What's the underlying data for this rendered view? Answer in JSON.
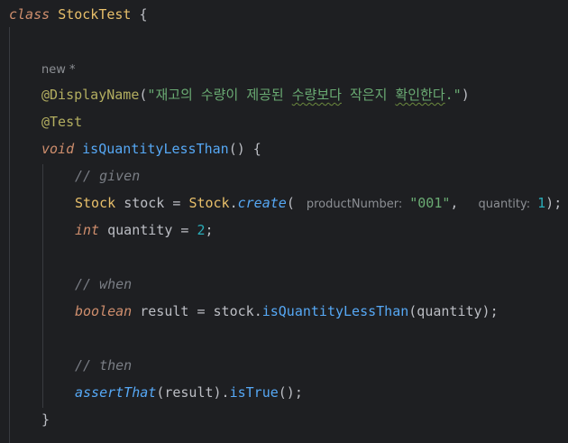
{
  "editor": {
    "lines": {
      "class_kw": "class",
      "class_name": "StockTest",
      "class_open": " {",
      "new_hint": "new *",
      "display_name_ann": "@DisplayName",
      "display_name_open": "(",
      "display_name_quote_open": "\"",
      "display_name_w1": "재고의",
      "display_name_w2": "수량이",
      "display_name_w3": "제공된",
      "display_name_w4": "수량보다",
      "display_name_w5": "작은지",
      "display_name_w6": "확인한다",
      "display_name_w6b": ".",
      "display_name_quote_close": "\"",
      "display_name_close": ")",
      "test_ann": "@Test",
      "method_type": "void",
      "method_name": "isQuantityLessThan",
      "method_sig_rest": "() {",
      "comment_given": "// given",
      "stock_type": "Stock",
      "stock_var": "stock",
      "assign": "=",
      "stock_class": "Stock",
      "dot": ".",
      "create_call": "create",
      "paren_open": "(",
      "hint_product": "productNumber:",
      "product_value": "\"001\"",
      "comma": ",",
      "hint_quantity": "quantity:",
      "quantity_value": "1",
      "paren_close_semi": ");",
      "int_type": "int",
      "quantity_var": "quantity",
      "quantity_init": "2",
      "semi": ";",
      "comment_when": "// when",
      "bool_type": "boolean",
      "result_var": "result",
      "stock_ref": "stock",
      "method_call": "isQuantityLessThan",
      "call_args": "(quantity);",
      "comment_then": "// then",
      "assert_call": "assertThat",
      "assert_args": "(result).",
      "is_true": "isTrue",
      "is_true_end": "();",
      "method_close": "}"
    }
  },
  "colors": {
    "background": "#1e1f22",
    "keyword": "#cf8e6d",
    "string": "#6aab73",
    "number": "#2aacb8",
    "comment": "#7a7e85",
    "method": "#56a8f5",
    "annotation": "#b3ae60"
  }
}
